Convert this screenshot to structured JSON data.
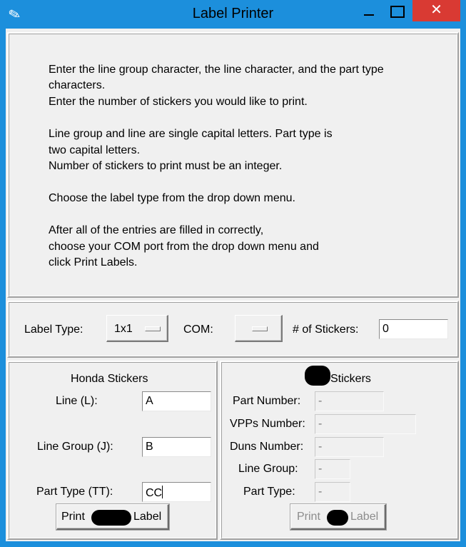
{
  "window": {
    "title": "Label Printer",
    "app_icon": "feather-icon",
    "close_glyph": "✕"
  },
  "instructions": {
    "lines": [
      "Enter the line group character, the line character, and the part type",
      "characters.",
      "Enter the number of stickers you would like to print.",
      "Line group and line are single capital letters. Part type is",
      "two capital letters.",
      "Number of stickers to print must be an integer.",
      "Choose the label type from the drop down menu.",
      "After all of the entries are filled in correctly,",
      "choose your COM port from the drop down menu and",
      "click Print Labels."
    ]
  },
  "options": {
    "label_type_label": "Label Type:",
    "label_type_value": "1x1",
    "com_label": "COM:",
    "com_value": "",
    "stickers_label": "# of Stickers:",
    "stickers_value": "0"
  },
  "honda": {
    "title": "Honda Stickers",
    "line_label": "Line (L):",
    "line_value": "A",
    "line_group_label": "Line Group (J):",
    "line_group_value": "B",
    "part_type_label": "Part Type (TT):",
    "part_type_value": "CC",
    "print_prefix": "Print",
    "print_suffix": "Label"
  },
  "other": {
    "title_suffix": "Stickers",
    "part_number_label": "Part Number:",
    "part_number_value": "-",
    "vpps_label": "VPPs Number:",
    "vpps_value": "-",
    "duns_label": "Duns Number:",
    "duns_value": "-",
    "line_group_label": "Line Group:",
    "line_group_value": "-",
    "part_type_label": "Part Type:",
    "part_type_value": "-",
    "print_prefix": "Print",
    "print_suffix": "Label"
  },
  "colors": {
    "titlebar": "#1c8fdc",
    "close_button": "#d93a33",
    "window_bg": "#f0f0f0"
  }
}
